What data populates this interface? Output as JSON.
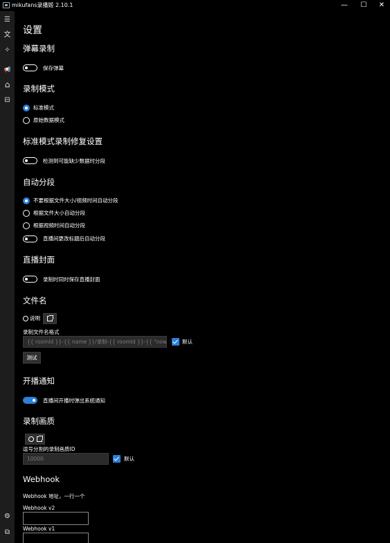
{
  "window": {
    "title": "mikufans录播姬 2.10.1",
    "minimize": "—",
    "maximize": "☐",
    "close": "✕"
  },
  "sidebar": {
    "items": [
      {
        "icon": "hamburger-icon",
        "glyph": "☰"
      },
      {
        "icon": "translate-icon",
        "glyph": "文"
      },
      {
        "icon": "magic-wand-icon",
        "glyph": "✧"
      },
      {
        "icon": "megaphone-icon",
        "glyph": "📢"
      },
      {
        "icon": "home-icon",
        "glyph": "⌂"
      },
      {
        "icon": "inbox-icon",
        "glyph": "⊟"
      }
    ],
    "bottom": [
      {
        "icon": "gear-icon",
        "glyph": "⚙"
      },
      {
        "icon": "logs-icon",
        "glyph": "⧉"
      }
    ]
  },
  "page": {
    "title": "设置"
  },
  "danmaku": {
    "heading": "弹幕录制",
    "save_danmaku": "保存弹幕",
    "save_danmaku_on": false
  },
  "record_mode": {
    "heading": "录制模式",
    "options": [
      "标准模式",
      "原始数据模式"
    ],
    "selected": 0
  },
  "fix_settings": {
    "heading": "标准模式录制修复设置",
    "split_on_missing": "检测到可能缺少数据时分段",
    "split_on_missing_on": false
  },
  "auto_split": {
    "heading": "自动分段",
    "options": [
      "不要根据文件大小/视频时间自动分段",
      "根据文件大小自动分段",
      "根据视频时间自动分段"
    ],
    "selected": 0,
    "split_on_title_change": "直播间更改标题后自动分段",
    "split_on_title_change_on": false
  },
  "cover": {
    "heading": "直播封面",
    "save_cover": "录制时同时保存直播封面",
    "save_cover_on": false
  },
  "filename": {
    "heading": "文件名",
    "help_label": "说明",
    "format_label": "录制文件名格式",
    "format_value": "{{ roomId }}-{{ name }}/录制-{{ roomId }}-{{ \"now\" | time_zone: \"Asia/Shanghai\" | format_date: \"yyyyMMdd-HHmmss-fff\" }}-{{ title }}.flv",
    "default_label": "默认",
    "test_button": "测试"
  },
  "notify": {
    "heading": "开播通知",
    "popup_label": "直播间开播时弹出系统通知",
    "popup_on": true
  },
  "quality": {
    "heading": "录制画质",
    "ids_label": "逗号分割的录制画质ID",
    "ids_placeholder": "10000",
    "default_label": "默认"
  },
  "webhook": {
    "heading": "Webhook",
    "desc": "Webhook 地址，一行一个",
    "v2_label": "Webhook v2",
    "v1_label": "Webhook v1"
  },
  "colors": {
    "accent": "#2e7fd8",
    "background": "#000000",
    "sidebar": "#1d1d1d"
  }
}
